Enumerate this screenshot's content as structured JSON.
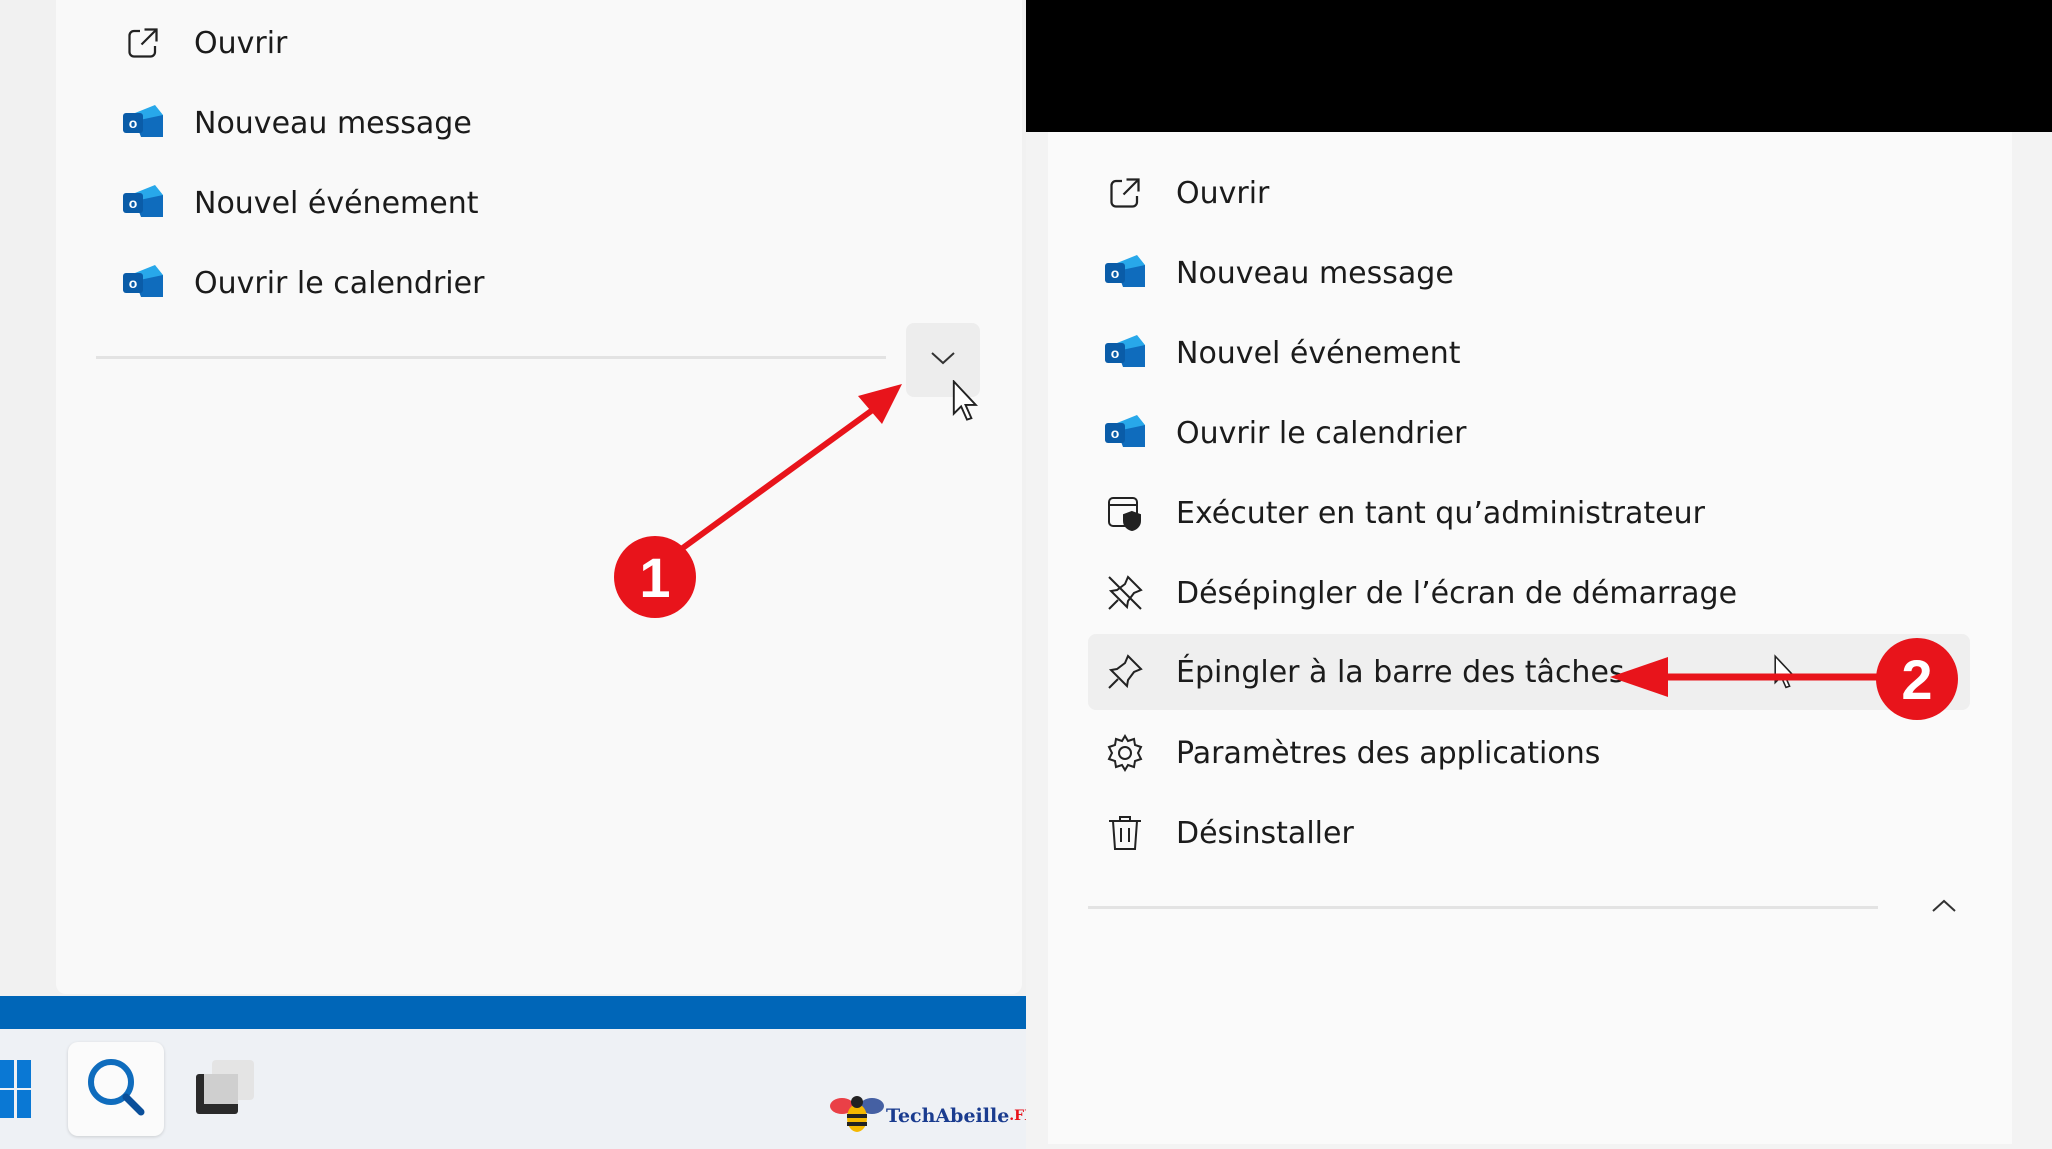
{
  "left_menu": {
    "items": [
      {
        "label": "Ouvrir",
        "icon": "open-external-icon"
      },
      {
        "label": "Nouveau message",
        "icon": "outlook-icon"
      },
      {
        "label": "Nouvel événement",
        "icon": "outlook-icon"
      },
      {
        "label": "Ouvrir le calendrier",
        "icon": "outlook-icon"
      }
    ],
    "expand_icon": "chevron-down-icon"
  },
  "right_menu": {
    "items": [
      {
        "label": "Ouvrir",
        "icon": "open-external-icon"
      },
      {
        "label": "Nouveau message",
        "icon": "outlook-icon"
      },
      {
        "label": "Nouvel événement",
        "icon": "outlook-icon"
      },
      {
        "label": "Ouvrir le calendrier",
        "icon": "outlook-icon"
      },
      {
        "label": "Exécuter en tant qu’administrateur",
        "icon": "admin-shield-icon"
      },
      {
        "label": "Désépingler de l’écran de démarrage",
        "icon": "unpin-icon"
      },
      {
        "label": "Épingler à la barre des tâches",
        "icon": "pin-icon"
      },
      {
        "label": "Paramètres des applications",
        "icon": "gear-icon"
      },
      {
        "label": "Désinstaller",
        "icon": "trash-icon"
      }
    ],
    "collapse_icon": "chevron-up-icon"
  },
  "callouts": {
    "one": "1",
    "two": "2"
  },
  "watermark": {
    "text": "TechAbeille",
    "suffix": ".FR"
  },
  "colors": {
    "accent_blue": "#0066b8",
    "callout_red": "#e8141b",
    "outlook_blue": "#0f6cbd"
  }
}
